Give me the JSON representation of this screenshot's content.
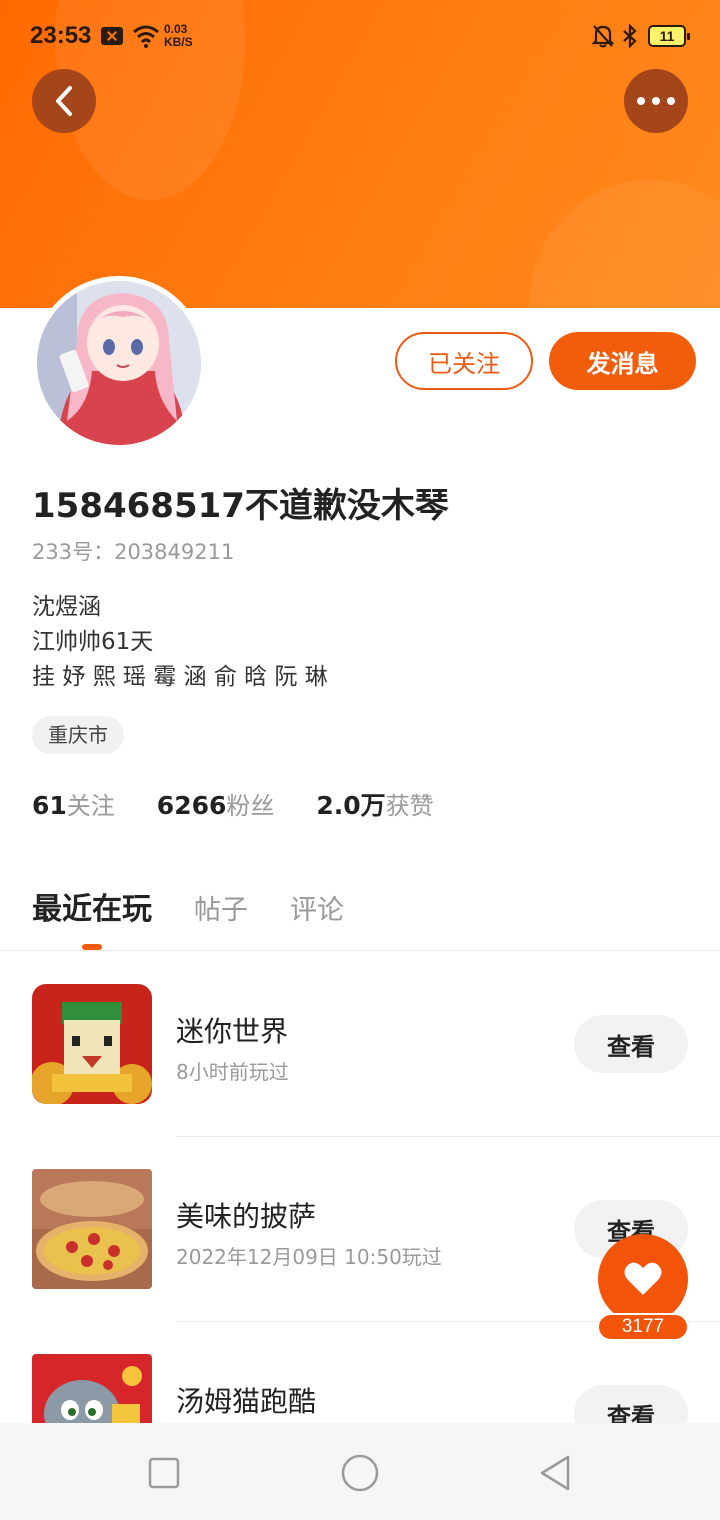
{
  "status_bar": {
    "time": "23:53",
    "speed_value": "0.03",
    "speed_unit": "KB/S",
    "battery": "11"
  },
  "profile": {
    "follow_button": "已关注",
    "message_button": "发消息",
    "username": "158468517不道歉没木琴",
    "uid_text": "233号：203849211",
    "bio_lines": [
      "沈煜涵",
      "江帅帅61天",
      "挂 妤 熙 瑶 霉 涵 俞 晗 阮 琳"
    ],
    "location": "重庆市",
    "stats": {
      "following_count": "61",
      "following_label": "关注",
      "fans_count": "6266",
      "fans_label": "粉丝",
      "likes_count": "2.0万",
      "likes_label": "获赞"
    }
  },
  "tabs": [
    {
      "label": "最近在玩",
      "active": true
    },
    {
      "label": "帖子",
      "active": false
    },
    {
      "label": "评论",
      "active": false
    }
  ],
  "games": [
    {
      "name": "迷你世界",
      "played": "8小时前玩过",
      "button": "查看"
    },
    {
      "name": "美味的披萨",
      "played": "2022年12月09日 10:50玩过",
      "button": "查看"
    },
    {
      "name": "汤姆猫跑酷",
      "played": "",
      "button": "查看"
    }
  ],
  "like_fab": {
    "count": "3177"
  },
  "colors": {
    "accent": "#f25d0c",
    "banner": "#ff7a10"
  },
  "icons": {
    "back": "chevron-left-icon",
    "more": "more-dots-icon",
    "like": "heart-icon",
    "nav": [
      "square-recent-icon",
      "circle-home-icon",
      "triangle-back-icon"
    ]
  }
}
